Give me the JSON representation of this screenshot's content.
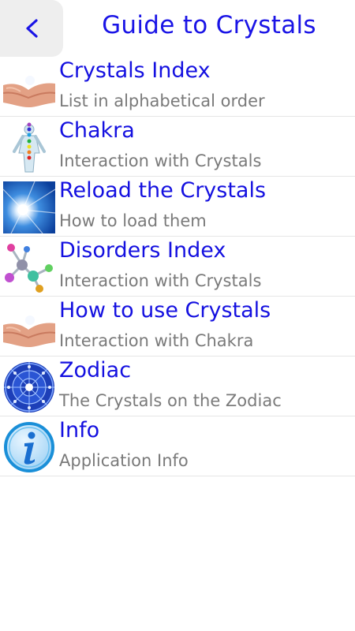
{
  "header": {
    "back_label": "<",
    "title": "Guide to Crystals"
  },
  "items": [
    {
      "title": "Crystals Index",
      "subtitle": "List in alphabetical order",
      "icon": "hands-crystal-icon"
    },
    {
      "title": "Chakra",
      "subtitle": "Interaction with Crystals",
      "icon": "chakra-body-icon"
    },
    {
      "title": "Reload the Crystals",
      "subtitle": "How to load them",
      "icon": "sunburst-icon"
    },
    {
      "title": "Disorders Index",
      "subtitle": "Interaction with Crystals",
      "icon": "molecule-icon"
    },
    {
      "title": "How to use Crystals",
      "subtitle": "Interaction with Chakra",
      "icon": "hands-crystal-icon"
    },
    {
      "title": "Zodiac",
      "subtitle": "The Crystals on the Zodiac",
      "icon": "zodiac-wheel-icon"
    },
    {
      "title": "Info",
      "subtitle": "Application Info",
      "icon": "info-icon"
    }
  ],
  "colors": {
    "title_blue": "#1a14e6",
    "subtitle_gray": "#7a7a7a",
    "back_button_bg": "#eeeeee"
  }
}
